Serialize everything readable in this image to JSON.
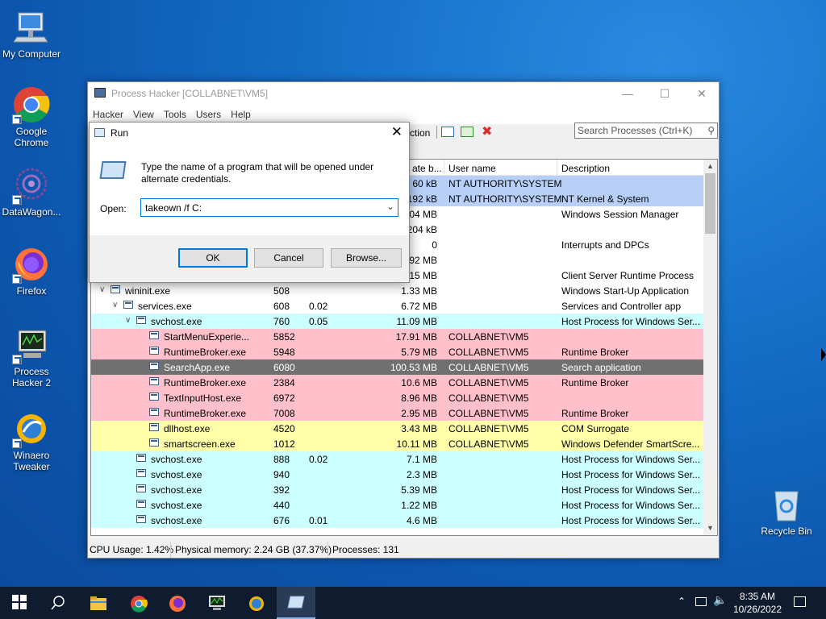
{
  "desktop": {
    "icons": [
      {
        "label": "My Computer",
        "icon": "computer-icon"
      },
      {
        "label": "Google Chrome",
        "icon": "chrome-icon"
      },
      {
        "label": "DataWagon...",
        "icon": "datawagon-icon"
      },
      {
        "label": "Firefox",
        "icon": "firefox-icon"
      },
      {
        "label": "Process Hacker 2",
        "icon": "process-hacker-icon"
      },
      {
        "label": "Winaero Tweaker",
        "icon": "winaero-icon"
      }
    ],
    "recycle_bin": "Recycle Bin"
  },
  "process_hacker": {
    "title": "Process Hacker [COLLABNET\\VM5]",
    "menu": [
      "Hacker",
      "View",
      "Tools",
      "Users",
      "Help"
    ],
    "toolbar_partial": "ction",
    "search_placeholder": "Search Processes (Ctrl+K)",
    "columns": {
      "private_bytes": "ate b...",
      "user_name": "User name",
      "description": "Description"
    },
    "rows": [
      {
        "name": "",
        "pid": "",
        "cpu": "",
        "mem": "60 kB",
        "user": "NT AUTHORITY\\SYSTEM",
        "desc": "",
        "color": "#b8d0f8",
        "indent": 0
      },
      {
        "name": "",
        "pid": "",
        "cpu": "",
        "mem": "192 kB",
        "user": "NT AUTHORITY\\SYSTEM",
        "desc": "NT Kernel & System",
        "color": "#b8d0f8",
        "indent": 0
      },
      {
        "name": "",
        "pid": "",
        "cpu": "",
        "mem": "04 MB",
        "user": "",
        "desc": "Windows Session Manager",
        "color": "#ffffff",
        "indent": 0
      },
      {
        "name": "",
        "pid": "",
        "cpu": "",
        "mem": "204 kB",
        "user": "",
        "desc": "",
        "color": "#ffffff",
        "indent": 0
      },
      {
        "name": "",
        "pid": "",
        "cpu": "",
        "mem": "0",
        "user": "",
        "desc": "Interrupts and DPCs",
        "color": "#ffffff",
        "indent": 0
      },
      {
        "name": "",
        "pid": "",
        "cpu": "",
        "mem": "92 MB",
        "user": "",
        "desc": "",
        "color": "#ffffff",
        "indent": 0
      },
      {
        "name": "",
        "pid": "",
        "cpu": "",
        "mem": "15 MB",
        "user": "",
        "desc": "Client Server Runtime Process",
        "color": "#ffffff",
        "indent": 0
      },
      {
        "name": "wininit.exe",
        "pid": "508",
        "cpu": "",
        "mem": "1.33 MB",
        "user": "",
        "desc": "Windows Start-Up Application",
        "color": "#ffffff",
        "indent": 0,
        "exp": "v"
      },
      {
        "name": "services.exe",
        "pid": "608",
        "cpu": "0.02",
        "mem": "6.72 MB",
        "user": "",
        "desc": "Services and Controller app",
        "color": "#ffffff",
        "indent": 1,
        "exp": "v"
      },
      {
        "name": "svchost.exe",
        "pid": "760",
        "cpu": "0.05",
        "mem": "11.09 MB",
        "user": "",
        "desc": "Host Process for Windows Ser...",
        "color": "#ccffff",
        "indent": 2,
        "exp": "v"
      },
      {
        "name": "StartMenuExperie...",
        "pid": "5852",
        "cpu": "",
        "mem": "17.91 MB",
        "user": "COLLABNET\\VM5",
        "desc": "",
        "color": "#ffc0cb",
        "indent": 3
      },
      {
        "name": "RuntimeBroker.exe",
        "pid": "5948",
        "cpu": "",
        "mem": "5.79 MB",
        "user": "COLLABNET\\VM5",
        "desc": "Runtime Broker",
        "color": "#ffc0cb",
        "indent": 3
      },
      {
        "name": "SearchApp.exe",
        "pid": "6080",
        "cpu": "",
        "mem": "100.53 MB",
        "user": "COLLABNET\\VM5",
        "desc": "Search application",
        "color": "#707070",
        "indent": 3
      },
      {
        "name": "RuntimeBroker.exe",
        "pid": "2384",
        "cpu": "",
        "mem": "10.6 MB",
        "user": "COLLABNET\\VM5",
        "desc": "Runtime Broker",
        "color": "#ffc0cb",
        "indent": 3
      },
      {
        "name": "TextInputHost.exe",
        "pid": "6972",
        "cpu": "",
        "mem": "8.96 MB",
        "user": "COLLABNET\\VM5",
        "desc": "",
        "color": "#ffc0cb",
        "indent": 3
      },
      {
        "name": "RuntimeBroker.exe",
        "pid": "7008",
        "cpu": "",
        "mem": "2.95 MB",
        "user": "COLLABNET\\VM5",
        "desc": "Runtime Broker",
        "color": "#ffc0cb",
        "indent": 3
      },
      {
        "name": "dllhost.exe",
        "pid": "4520",
        "cpu": "",
        "mem": "3.43 MB",
        "user": "COLLABNET\\VM5",
        "desc": "COM Surrogate",
        "color": "#ffffaa",
        "indent": 3
      },
      {
        "name": "smartscreen.exe",
        "pid": "1012",
        "cpu": "",
        "mem": "10.11 MB",
        "user": "COLLABNET\\VM5",
        "desc": "Windows Defender SmartScre...",
        "color": "#ffffaa",
        "indent": 3
      },
      {
        "name": "svchost.exe",
        "pid": "888",
        "cpu": "0.02",
        "mem": "7.1 MB",
        "user": "",
        "desc": "Host Process for Windows Ser...",
        "color": "#ccffff",
        "indent": 2
      },
      {
        "name": "svchost.exe",
        "pid": "940",
        "cpu": "",
        "mem": "2.3 MB",
        "user": "",
        "desc": "Host Process for Windows Ser...",
        "color": "#ccffff",
        "indent": 2
      },
      {
        "name": "svchost.exe",
        "pid": "392",
        "cpu": "",
        "mem": "5.39 MB",
        "user": "",
        "desc": "Host Process for Windows Ser...",
        "color": "#ccffff",
        "indent": 2
      },
      {
        "name": "svchost.exe",
        "pid": "440",
        "cpu": "",
        "mem": "1.22 MB",
        "user": "",
        "desc": "Host Process for Windows Ser...",
        "color": "#ccffff",
        "indent": 2
      },
      {
        "name": "svchost.exe",
        "pid": "676",
        "cpu": "0.01",
        "mem": "4.6 MB",
        "user": "",
        "desc": "Host Process for Windows Ser...",
        "color": "#ccffff",
        "indent": 2
      }
    ],
    "status": {
      "cpu": "CPU Usage: 1.42%",
      "memory": "Physical memory: 2.24 GB (37.37%)",
      "processes": "Processes: 131"
    }
  },
  "run_dialog": {
    "title": "Run",
    "message": "Type the name of a program that will be opened under alternate credentials.",
    "open_label": "Open:",
    "open_value": "takeown /f C:",
    "ok": "OK",
    "cancel": "Cancel",
    "browse": "Browse..."
  },
  "taskbar": {
    "time": "8:35 AM",
    "date": "10/26/2022",
    "accent": "#0f1b2e"
  }
}
